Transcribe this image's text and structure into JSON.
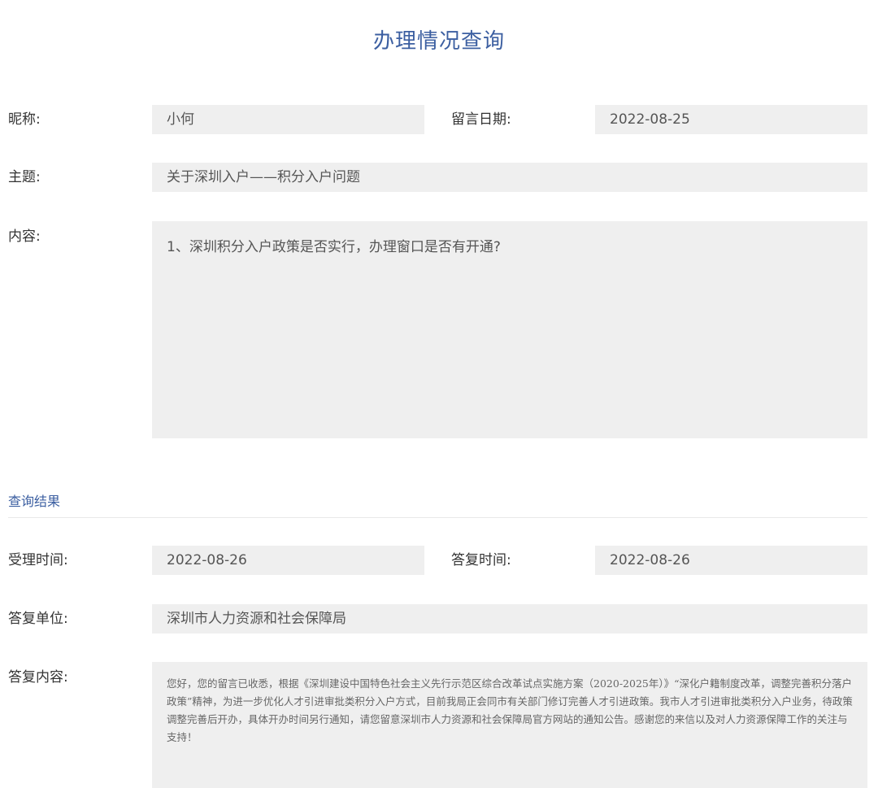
{
  "page": {
    "title": "办理情况查询"
  },
  "inquiry": {
    "nickname_label": "昵称:",
    "nickname_value": "小何",
    "date_label": "留言日期:",
    "date_value": "2022-08-25",
    "subject_label": "主题:",
    "subject_value": "关于深圳入户——积分入户问题",
    "content_label": "内容:",
    "content_value": "1、深圳积分入户政策是否实行，办理窗口是否有开通?"
  },
  "result": {
    "section_title": "查询结果",
    "accept_time_label": "受理时间:",
    "accept_time_value": "2022-08-26",
    "reply_time_label": "答复时间:",
    "reply_time_value": "2022-08-26",
    "reply_unit_label": "答复单位:",
    "reply_unit_value": "深圳市人力资源和社会保障局",
    "reply_content_label": "答复内容:",
    "reply_content_value": "您好，您的留言已收悉，根据《深圳建设中国特色社会主义先行示范区综合改革试点实施方案（2020-2025年）》“深化户籍制度改革，调整完善积分落户政策”精神，为进一步优化人才引进审批类积分入户方式，目前我局正会同市有关部门修订完善人才引进政策。我市人才引进审批类积分入户业务，待政策调整完善后开办，具体开办时间另行通知，请您留意深圳市人力资源和社会保障局官方网站的通知公告。感谢您的来信以及对人力资源保障工作的关注与支持！"
  },
  "colors": {
    "accent": "#3c5fa1",
    "field_bg": "#efefef",
    "label_text": "#333333"
  }
}
